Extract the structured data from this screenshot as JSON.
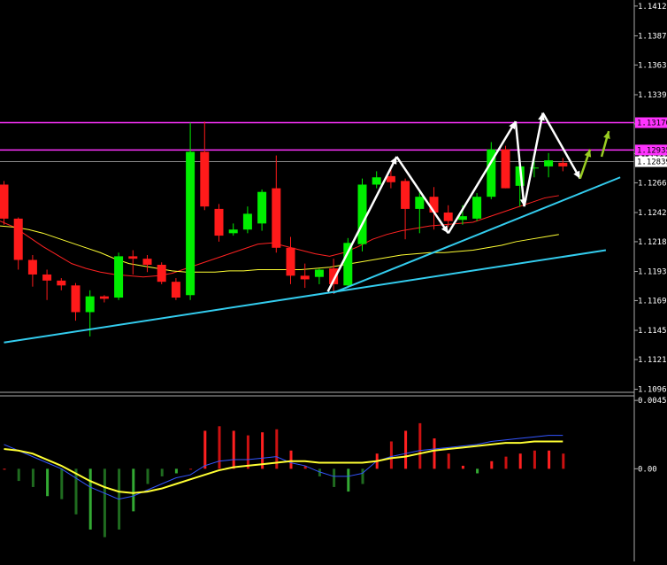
{
  "chart_data": [
    {
      "type": "candlestick",
      "title": "",
      "price_ticks": [
        "1.14120",
        "1.13875",
        "1.13635",
        "1.13390",
        "1.13150",
        "1.12905",
        "1.12665",
        "1.12420",
        "1.12180",
        "1.11935",
        "1.11695",
        "1.11450",
        "1.11210",
        "1.10965"
      ],
      "ylim": [
        1.1094,
        1.1417
      ],
      "horizontal_levels": [
        {
          "label": "1.13170",
          "value": 1.1316,
          "color": "#ff33ff"
        },
        {
          "label": "1.12935",
          "value": 1.12935,
          "color": "#ff33ff"
        }
      ],
      "current_price": {
        "label": "1.12839",
        "value": 1.12839
      },
      "candles": [
        {
          "o": 1.1265,
          "h": 1.1268,
          "l": 1.1232,
          "c": 1.1237
        },
        {
          "o": 1.1237,
          "h": 1.1238,
          "l": 1.1195,
          "c": 1.1203
        },
        {
          "o": 1.1203,
          "h": 1.1207,
          "l": 1.1181,
          "c": 1.1191
        },
        {
          "o": 1.1191,
          "h": 1.1195,
          "l": 1.117,
          "c": 1.1186
        },
        {
          "o": 1.1186,
          "h": 1.1188,
          "l": 1.1178,
          "c": 1.1182
        },
        {
          "o": 1.1182,
          "h": 1.1184,
          "l": 1.1153,
          "c": 1.116
        },
        {
          "o": 1.116,
          "h": 1.1178,
          "l": 1.114,
          "c": 1.1173
        },
        {
          "o": 1.1173,
          "h": 1.1174,
          "l": 1.1168,
          "c": 1.1171
        },
        {
          "o": 1.1172,
          "h": 1.1209,
          "l": 1.117,
          "c": 1.1206
        },
        {
          "o": 1.1206,
          "h": 1.1211,
          "l": 1.1191,
          "c": 1.1204
        },
        {
          "o": 1.1204,
          "h": 1.1207,
          "l": 1.1193,
          "c": 1.1199
        },
        {
          "o": 1.1199,
          "h": 1.1201,
          "l": 1.1183,
          "c": 1.1185
        },
        {
          "o": 1.1185,
          "h": 1.1188,
          "l": 1.117,
          "c": 1.1172
        },
        {
          "o": 1.1174,
          "h": 1.1316,
          "l": 1.117,
          "c": 1.1292
        },
        {
          "o": 1.1292,
          "h": 1.1317,
          "l": 1.1244,
          "c": 1.1247
        },
        {
          "o": 1.1245,
          "h": 1.1249,
          "l": 1.1218,
          "c": 1.1223
        },
        {
          "o": 1.1225,
          "h": 1.1233,
          "l": 1.1223,
          "c": 1.1228
        },
        {
          "o": 1.1228,
          "h": 1.1247,
          "l": 1.1225,
          "c": 1.1241
        },
        {
          "o": 1.1233,
          "h": 1.1261,
          "l": 1.1227,
          "c": 1.1259
        },
        {
          "o": 1.1262,
          "h": 1.1289,
          "l": 1.1209,
          "c": 1.1213
        },
        {
          "o": 1.1213,
          "h": 1.1222,
          "l": 1.1183,
          "c": 1.119
        },
        {
          "o": 1.119,
          "h": 1.12,
          "l": 1.118,
          "c": 1.1187
        },
        {
          "o": 1.1189,
          "h": 1.1196,
          "l": 1.1183,
          "c": 1.1195
        },
        {
          "o": 1.1196,
          "h": 1.1204,
          "l": 1.1175,
          "c": 1.1183
        },
        {
          "o": 1.1182,
          "h": 1.1221,
          "l": 1.118,
          "c": 1.1217
        },
        {
          "o": 1.1216,
          "h": 1.127,
          "l": 1.121,
          "c": 1.1265
        },
        {
          "o": 1.1265,
          "h": 1.1276,
          "l": 1.1262,
          "c": 1.1271
        },
        {
          "o": 1.1272,
          "h": 1.1278,
          "l": 1.1262,
          "c": 1.1267
        },
        {
          "o": 1.1268,
          "h": 1.127,
          "l": 1.122,
          "c": 1.1245
        },
        {
          "o": 1.1245,
          "h": 1.126,
          "l": 1.1225,
          "c": 1.1255
        },
        {
          "o": 1.1255,
          "h": 1.1263,
          "l": 1.1228,
          "c": 1.1242
        },
        {
          "o": 1.1242,
          "h": 1.1248,
          "l": 1.123,
          "c": 1.1235
        },
        {
          "o": 1.1236,
          "h": 1.1248,
          "l": 1.1232,
          "c": 1.1239
        },
        {
          "o": 1.1237,
          "h": 1.1258,
          "l": 1.1235,
          "c": 1.1255
        },
        {
          "o": 1.1255,
          "h": 1.13,
          "l": 1.1253,
          "c": 1.1294
        },
        {
          "o": 1.1294,
          "h": 1.1297,
          "l": 1.1262,
          "c": 1.1262
        },
        {
          "o": 1.1264,
          "h": 1.1282,
          "l": 1.1247,
          "c": 1.128
        },
        {
          "o": 1.1279,
          "h": 1.1286,
          "l": 1.1271,
          "c": 1.1279
        },
        {
          "o": 1.128,
          "h": 1.1291,
          "l": 1.1271,
          "c": 1.1285
        },
        {
          "o": 1.1283,
          "h": 1.1287,
          "l": 1.1276,
          "c": 1.128
        }
      ],
      "moving_averages": [
        {
          "color": "#ff2222",
          "values": [
            1.1235,
            1.123,
            1.1222,
            1.1214,
            1.1207,
            1.12,
            1.1196,
            1.1193,
            1.1191,
            1.119,
            1.1189,
            1.119,
            1.1192,
            1.1196,
            1.12,
            1.1204,
            1.1208,
            1.1212,
            1.1216,
            1.1217,
            1.1214,
            1.1211,
            1.1208,
            1.1206,
            1.1209,
            1.1214,
            1.122,
            1.1224,
            1.1227,
            1.1229,
            1.1231,
            1.1232,
            1.1233,
            1.1234,
            1.1238,
            1.1242,
            1.1246,
            1.125,
            1.1254,
            1.1256
          ]
        },
        {
          "color": "#ffff33",
          "values": [
            1.1231,
            1.123,
            1.1228,
            1.1225,
            1.1221,
            1.1217,
            1.1213,
            1.1209,
            1.1204,
            1.12,
            1.1198,
            1.1196,
            1.1194,
            1.1193,
            1.1193,
            1.1193,
            1.1194,
            1.1194,
            1.1195,
            1.1195,
            1.1195,
            1.1195,
            1.1196,
            1.1197,
            1.1199,
            1.1201,
            1.1203,
            1.1205,
            1.1207,
            1.1208,
            1.1209,
            1.1209,
            1.121,
            1.1211,
            1.1213,
            1.1215,
            1.1218,
            1.122,
            1.1222,
            1.1224
          ]
        }
      ],
      "trendlines": [
        {
          "color": "#33ccee",
          "points": [
            [
              0,
              1.1135
            ],
            [
              42,
              1.1211
            ]
          ]
        },
        {
          "color": "#33ccee",
          "points": [
            [
              23,
              1.1176
            ],
            [
              43,
              1.1271
            ]
          ]
        }
      ],
      "zigzag_arrows": [
        [
          [
            22.6,
            1.1177
          ],
          [
            27.4,
            1.1288
          ]
        ],
        [
          [
            27.4,
            1.1288
          ],
          [
            31.0,
            1.1225
          ]
        ],
        [
          [
            31.0,
            1.1225
          ],
          [
            35.7,
            1.1317
          ]
        ],
        [
          [
            35.7,
            1.1317
          ],
          [
            36.3,
            1.1247
          ]
        ],
        [
          [
            36.3,
            1.1247
          ],
          [
            37.6,
            1.1324
          ]
        ],
        [
          [
            37.6,
            1.1324
          ],
          [
            40.2,
            1.127
          ]
        ]
      ],
      "forecast_arrows": [
        [
          [
            40.2,
            1.127
          ],
          [
            40.9,
            1.1294
          ]
        ],
        [
          [
            41.7,
            1.1288
          ],
          [
            42.2,
            1.1309
          ]
        ]
      ]
    },
    {
      "type": "oscillator",
      "title": "",
      "ticks": [
        "0.00450",
        "0.00"
      ],
      "ylim": [
        -0.0061,
        0.0048
      ],
      "histogram": [
        0.0,
        -0.0008,
        -0.0012,
        -0.0018,
        -0.002,
        -0.003,
        -0.004,
        -0.0045,
        -0.004,
        -0.0028,
        -0.001,
        -0.0005,
        -0.0003,
        0.0,
        0.0025,
        0.0028,
        0.0025,
        0.0022,
        0.0024,
        0.0026,
        0.0012,
        0.0002,
        -0.0005,
        -0.0012,
        -0.0015,
        -0.001,
        0.001,
        0.0018,
        0.0025,
        0.003,
        0.002,
        0.001,
        0.0002,
        -0.0003,
        0.0005,
        0.0008,
        0.001,
        0.0012,
        0.0012,
        0.001
      ],
      "signal": {
        "color": "#ffff33",
        "values": [
          0.0013,
          0.0012,
          0.001,
          0.0006,
          0.0002,
          -0.0003,
          -0.0008,
          -0.0012,
          -0.0015,
          -0.0016,
          -0.0015,
          -0.0013,
          -0.001,
          -0.0007,
          -0.0004,
          -0.0001,
          0.0001,
          0.0002,
          0.0003,
          0.0004,
          0.0005,
          0.0005,
          0.0004,
          0.0004,
          0.0004,
          0.0004,
          0.0005,
          0.0007,
          0.0008,
          0.001,
          0.0012,
          0.0013,
          0.0014,
          0.0015,
          0.0016,
          0.0017,
          0.0017,
          0.0018,
          0.0018,
          0.0018
        ]
      },
      "main": {
        "color": "#3355ff",
        "values": [
          0.0016,
          0.0012,
          0.0008,
          0.0004,
          0.0,
          -0.0006,
          -0.0012,
          -0.0016,
          -0.002,
          -0.0018,
          -0.0014,
          -0.001,
          -0.0006,
          -0.0004,
          0.0002,
          0.0005,
          0.0006,
          0.0006,
          0.0007,
          0.0008,
          0.0004,
          0.0002,
          -0.0002,
          -0.0005,
          -0.0005,
          -0.0003,
          0.0005,
          0.0008,
          0.001,
          0.0012,
          0.0013,
          0.0014,
          0.0015,
          0.0016,
          0.0018,
          0.0019,
          0.002,
          0.0021,
          0.0022,
          0.0022
        ]
      }
    }
  ]
}
